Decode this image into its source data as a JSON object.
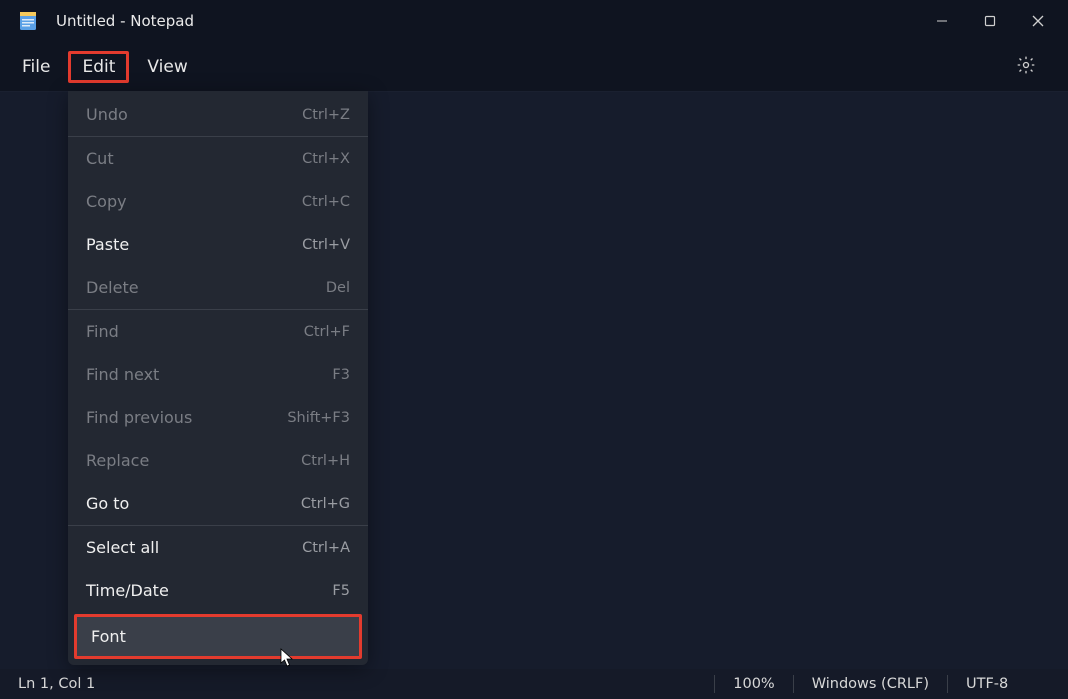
{
  "title": "Untitled - Notepad",
  "menubar": {
    "file": "File",
    "edit": "Edit",
    "view": "View"
  },
  "edit_menu": {
    "undo": {
      "label": "Undo",
      "shortcut": "Ctrl+Z",
      "enabled": false
    },
    "cut": {
      "label": "Cut",
      "shortcut": "Ctrl+X",
      "enabled": false
    },
    "copy": {
      "label": "Copy",
      "shortcut": "Ctrl+C",
      "enabled": false
    },
    "paste": {
      "label": "Paste",
      "shortcut": "Ctrl+V",
      "enabled": true
    },
    "delete": {
      "label": "Delete",
      "shortcut": "Del",
      "enabled": false
    },
    "find": {
      "label": "Find",
      "shortcut": "Ctrl+F",
      "enabled": false
    },
    "find_next": {
      "label": "Find next",
      "shortcut": "F3",
      "enabled": false
    },
    "find_prev": {
      "label": "Find previous",
      "shortcut": "Shift+F3",
      "enabled": false
    },
    "replace": {
      "label": "Replace",
      "shortcut": "Ctrl+H",
      "enabled": false
    },
    "goto": {
      "label": "Go to",
      "shortcut": "Ctrl+G",
      "enabled": true
    },
    "select_all": {
      "label": "Select all",
      "shortcut": "Ctrl+A",
      "enabled": true
    },
    "time_date": {
      "label": "Time/Date",
      "shortcut": "F5",
      "enabled": true
    },
    "font": {
      "label": "Font",
      "shortcut": "",
      "enabled": true
    }
  },
  "statusbar": {
    "pos": "Ln 1, Col 1",
    "zoom": "100%",
    "eol": "Windows (CRLF)",
    "encoding": "UTF-8"
  }
}
